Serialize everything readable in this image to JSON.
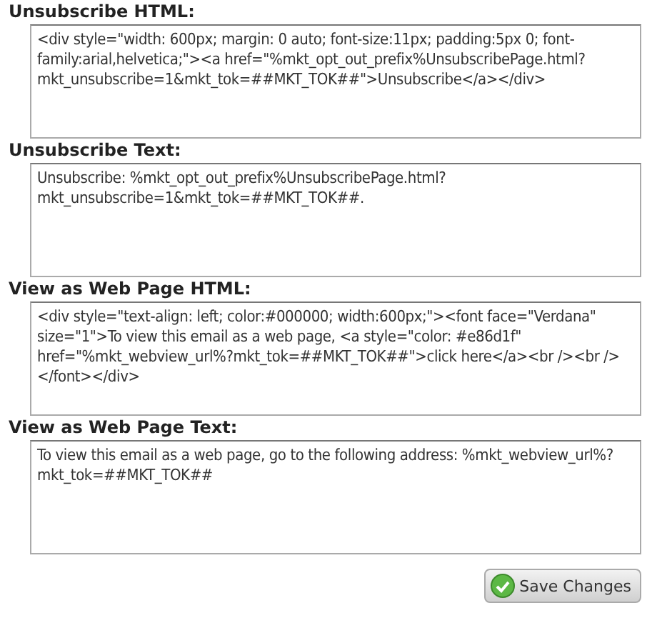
{
  "fields": [
    {
      "label": "Unsubscribe HTML:",
      "value": "<div style=\"width: 600px; margin: 0 auto; font-size:11px; padding:5px 0; font-family:arial,helvetica;\"><a href=\"%mkt_opt_out_prefix%UnsubscribePage.html?mkt_unsubscribe=1&mkt_tok=##MKT_TOK##\">Unsubscribe</a></div>"
    },
    {
      "label": "Unsubscribe Text:",
      "value": "Unsubscribe: %mkt_opt_out_prefix%UnsubscribePage.html?mkt_unsubscribe=1&mkt_tok=##MKT_TOK##."
    },
    {
      "label": "View as Web Page HTML:",
      "value": "<div style=\"text-align: left; color:#000000; width:600px;\"><font face=\"Verdana\" size=\"1\">To view this email as a web page, <a style=\"color: #e86d1f\" href=\"%mkt_webview_url%?mkt_tok=##MKT_TOK##\">click here</a><br /><br /></font></div>"
    },
    {
      "label": "View as Web Page Text:",
      "value": "To view this email as a web page, go to the following address: %mkt_webview_url%?mkt_tok=##MKT_TOK##"
    }
  ],
  "save_button": {
    "label": "Save Changes"
  }
}
